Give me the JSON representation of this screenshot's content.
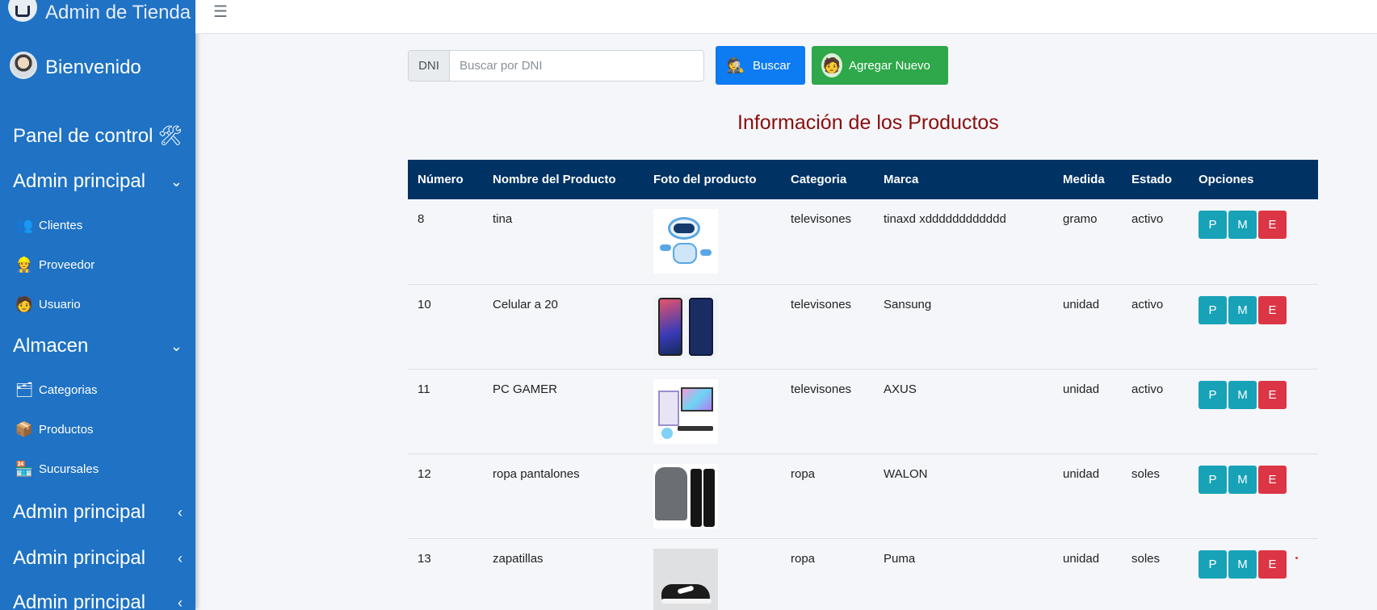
{
  "sidebar": {
    "brand": "Admin de Tienda",
    "user_name": "Bienvenido",
    "panel_label": "Panel de control",
    "section1_label": "Admin principal",
    "items1": [
      {
        "label": "Clientes",
        "icon": "people-icon"
      },
      {
        "label": "Proveedor",
        "icon": "supplier-icon"
      },
      {
        "label": "Usuario",
        "icon": "user-icon"
      }
    ],
    "section2_label": "Almacen",
    "items2": [
      {
        "label": "Categorias",
        "icon": "categories-icon"
      },
      {
        "label": "Productos",
        "icon": "products-icon"
      },
      {
        "label": "Sucursales",
        "icon": "store-icon"
      }
    ],
    "extra_sections": [
      "Admin principal",
      "Admin principal",
      "Admin principal"
    ]
  },
  "topbar": {
    "menu_icon": "hamburger-icon"
  },
  "search": {
    "label": "DNI",
    "placeholder": "Buscar por DNI",
    "search_button": "Buscar",
    "add_button": "Agregar Nuevo"
  },
  "title": "Información de los Productos",
  "table": {
    "headers": [
      "Número",
      "Nombre del Producto",
      "Foto del producto",
      "Categoria",
      "Marca",
      "Medida",
      "Estado",
      "Opciones"
    ],
    "rows": [
      {
        "numero": "8",
        "nombre": "tina",
        "foto": "robot",
        "categoria": "televisones",
        "marca": "tinaxd xdddddddddddd",
        "medida": "gramo",
        "estado": "activo"
      },
      {
        "numero": "10",
        "nombre": "Celular a 20",
        "foto": "phone",
        "categoria": "televisones",
        "marca": "Sansung",
        "medida": "unidad",
        "estado": "activo"
      },
      {
        "numero": "11",
        "nombre": "PC GAMER",
        "foto": "pc",
        "categoria": "televisones",
        "marca": "AXUS",
        "medida": "unidad",
        "estado": "activo"
      },
      {
        "numero": "12",
        "nombre": "ropa pantalones",
        "foto": "clothes",
        "categoria": "ropa",
        "marca": "WALON",
        "medida": "unidad",
        "estado": "soles"
      },
      {
        "numero": "13",
        "nombre": "zapatillas",
        "foto": "shoes",
        "categoria": "ropa",
        "marca": "Puma",
        "medida": "unidad",
        "estado": "soles"
      }
    ],
    "options": [
      "P",
      "M",
      "E"
    ]
  },
  "colors": {
    "sidebar": "#1f72c4",
    "header": "#003264",
    "title": "#8b0d0d",
    "info": "#17a2b8",
    "danger": "#dc3545",
    "primary": "#0d7bf2",
    "success": "#2ea84a"
  }
}
